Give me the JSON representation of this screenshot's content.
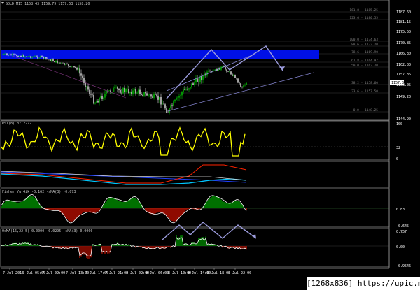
{
  "header": {
    "title": "GOLD,M15  1158.43 1159.79 1157.53 1158.20"
  },
  "price_axis": {
    "ticks": [
      "1187.60",
      "1181.15",
      "1175.50",
      "1170.85",
      "1166.30",
      "1162.00",
      "1157.35",
      "1153.05",
      "1149.20",
      "1144.90"
    ],
    "fib_labels": [
      "161.8 - 1185.25",
      "123.6 - 1180.55",
      "100.0 - 1174.63",
      "88.6 - 1172.20",
      "78.6 - 1169.90",
      "61.8 - 1164.97",
      "50.0 - 1162.70",
      "38.2 - 1158.60",
      "23.6 - 1157.50",
      "0.0 - 1148.25"
    ]
  },
  "rsi": {
    "title": "RSI(8) 37.2272",
    "ticks": [
      "100",
      "32",
      "0"
    ]
  },
  "panel3": {
    "ticks": [
      "",
      "",
      ""
    ]
  },
  "fisher": {
    "title": "Fisher_Yur4ik -0.162  -sMA(3) -0.073",
    "ticks": [
      "0.83",
      "-0.645"
    ]
  },
  "osma": {
    "title": "OsMA(16,22,5) 0.0000 -0.0295  -sMA(3) 0.0000",
    "ticks": [
      "0.757",
      "0.00",
      "-0.9546"
    ]
  },
  "time_axis": [
    "7 Jul 2015",
    "7 Jul 05:00",
    "7 Jul 09:00",
    "7 Jul 13:00",
    "7 Jul 17:00",
    "7 Jul 21:00",
    "8 Jul 02:00",
    "8 Jul 06:00",
    "8 Jul 10:00",
    "8 Jul 14:00",
    "8 Jul 18:00",
    "8 Jul 22:00"
  ],
  "watermark": "[1268x836] https://upic.me/",
  "colors": {
    "background": "#000000",
    "bull": "#00cc00",
    "bear": "#ffffff",
    "zone": "#0010e6",
    "rsi": "#ffff00",
    "arrow": "#9b9bdc",
    "accent_red": "#ff2200",
    "accent_cyan": "#00c8ff"
  }
}
